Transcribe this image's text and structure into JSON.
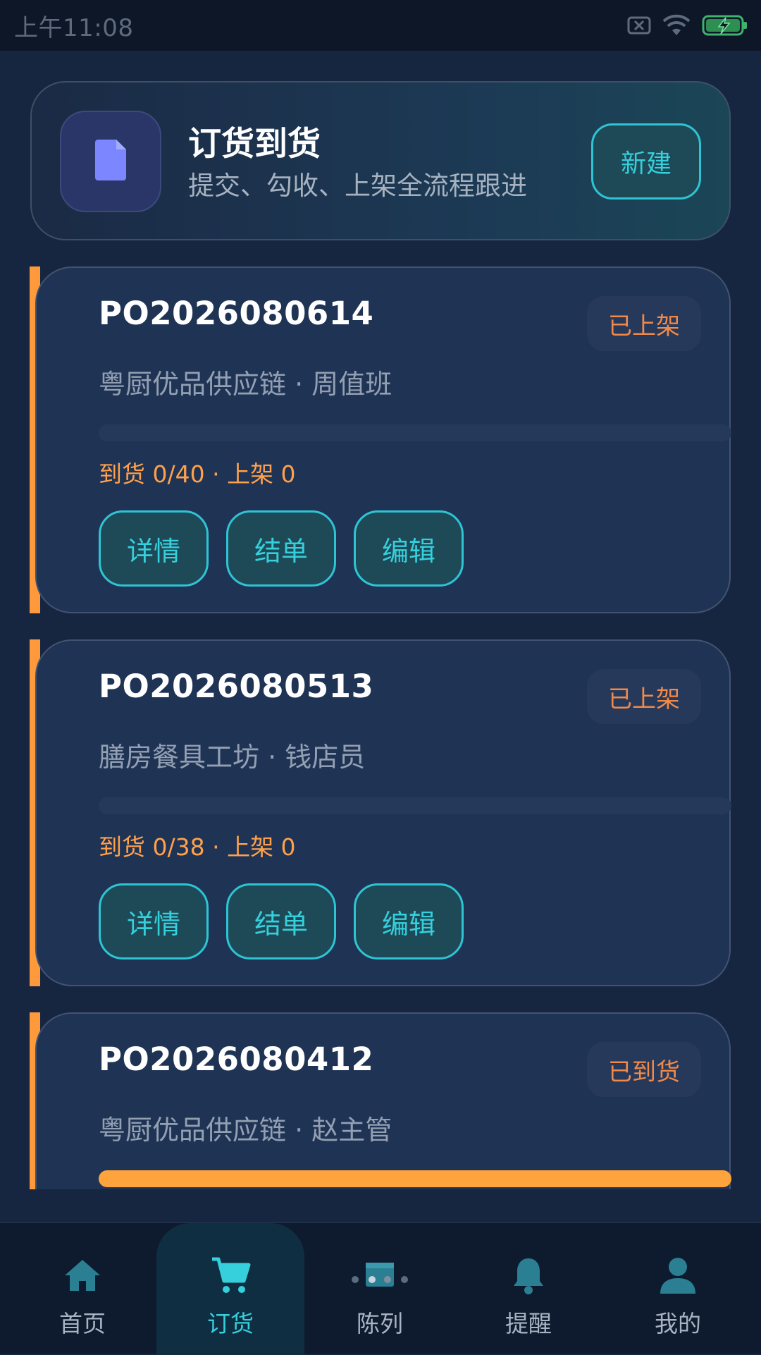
{
  "status_bar": {
    "time": "上午11:08",
    "icons": [
      "sim-card-off-icon",
      "wifi-icon",
      "battery-charging-icon"
    ]
  },
  "header": {
    "title": "订货到货",
    "subtitle": "提交、勾收、上架全流程跟进",
    "new_button": "新建",
    "icon": "document-icon"
  },
  "orders": [
    {
      "id": "PO2026080614",
      "status": "已上架",
      "meta": "粤厨优品供应链 · 周值班",
      "progress": 0,
      "stats": "到货 0/40 · 上架 0",
      "actions": [
        "详情",
        "结单",
        "编辑"
      ]
    },
    {
      "id": "PO2026080513",
      "status": "已上架",
      "meta": "膳房餐具工坊 · 钱店员",
      "progress": 0,
      "stats": "到货 0/38 · 上架 0",
      "actions": [
        "详情",
        "结单",
        "编辑"
      ]
    },
    {
      "id": "PO2026080412",
      "status": "已到货",
      "meta": "粤厨优品供应链 · 赵主管",
      "progress": 1
    }
  ],
  "colors": {
    "accent": "#ff9a3c",
    "teal": "#36cfdc",
    "badge_text": "#f0894a"
  },
  "tabbar": {
    "active": "tab-order",
    "items": [
      {
        "label": "首页",
        "icon": "home-icon"
      },
      {
        "label": "订货",
        "icon": "cart-icon"
      },
      {
        "label": "陈列",
        "icon": "shelf-display-icon"
      },
      {
        "label": "提醒",
        "icon": "bell-icon"
      },
      {
        "label": "我的",
        "icon": "user-icon"
      }
    ]
  }
}
